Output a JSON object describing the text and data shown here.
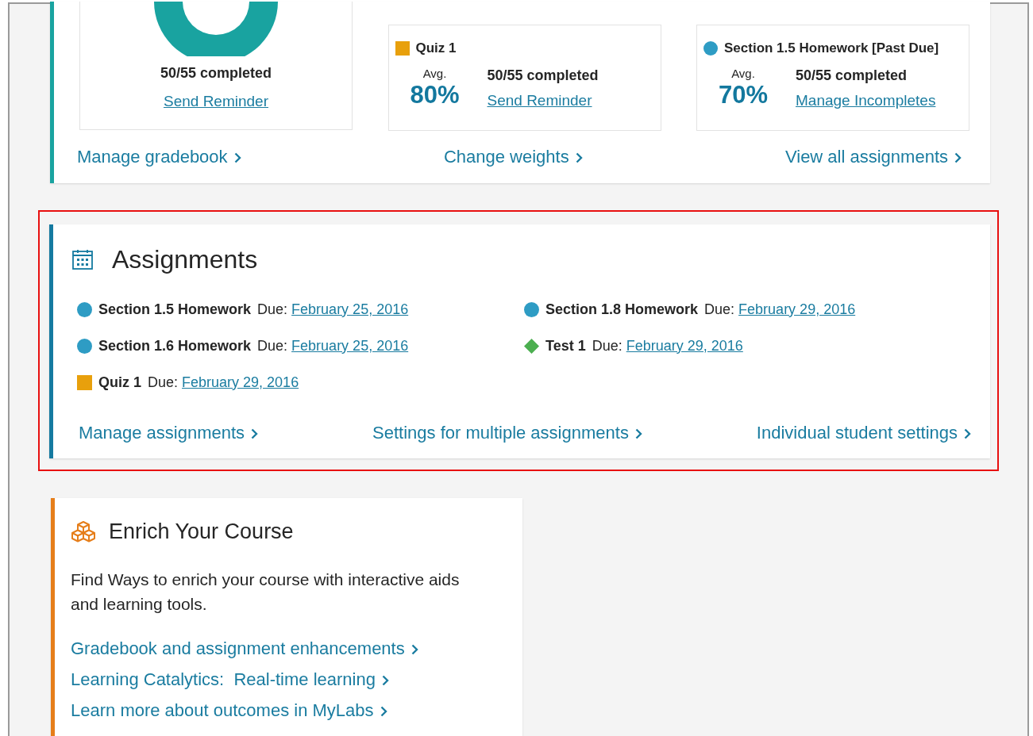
{
  "gradebook": {
    "donut_card": {
      "completed": "50/55 completed",
      "link": "Send Reminder"
    },
    "assignment_cards": [
      {
        "kind": "square",
        "color": "#e8a00c",
        "title": "Quiz 1",
        "avg_label": "Avg.",
        "avg": "80%",
        "completed": "50/55 completed",
        "link": "Send Reminder"
      },
      {
        "kind": "circle",
        "color": "#2e9cc4",
        "title": "Section 1.5 Homework [Past Due]",
        "avg_label": "Avg.",
        "avg": "70%",
        "completed": "50/55 completed",
        "link": "Manage Incompletes"
      }
    ],
    "links": [
      "Manage gradebook",
      "Change weights",
      "View all assignments"
    ]
  },
  "assignments": {
    "title": "Assignments",
    "highlighted": true,
    "items": [
      {
        "kind": "circle",
        "color": "#2e9cc4",
        "name": "Section 1.5 Homework",
        "due_label": "Due:",
        "due": "February 25, 2016"
      },
      {
        "kind": "circle",
        "color": "#2e9cc4",
        "name": "Section 1.8 Homework",
        "due_label": "Due:",
        "due": "February 29, 2016"
      },
      {
        "kind": "circle",
        "color": "#2e9cc4",
        "name": "Section 1.6 Homework",
        "due_label": "Due:",
        "due": "February 25, 2016"
      },
      {
        "kind": "diamond",
        "color": "#4caf50",
        "name": "Test 1",
        "due_label": "Due:",
        "due": "February 29, 2016"
      },
      {
        "kind": "square",
        "color": "#e8a00c",
        "name": "Quiz 1",
        "due_label": "Due:",
        "due": "February 29, 2016"
      }
    ],
    "links": [
      "Manage assignments",
      "Settings for multiple assignments",
      "Individual student settings"
    ]
  },
  "enrich": {
    "title": "Enrich Your Course",
    "description": "Find Ways to enrich your course with interactive aids and learning tools.",
    "links": [
      "Gradebook and assignment enhancements",
      "Learning Catalytics:  Real-time learning",
      "Learn more about outcomes in MyLabs"
    ]
  }
}
